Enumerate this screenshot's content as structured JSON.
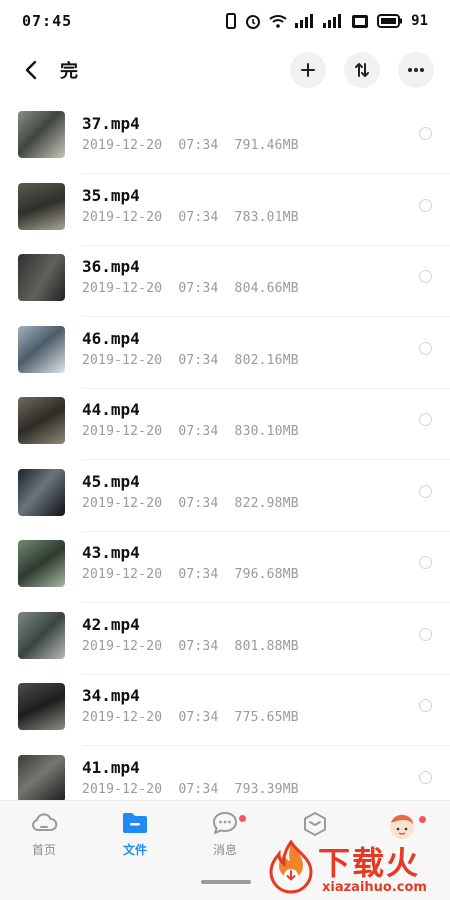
{
  "status_bar": {
    "time": "07:45",
    "battery_level": "91",
    "icons": [
      "vibrate-icon",
      "alarm-icon",
      "wifi-icon",
      "signal-icon",
      "signal-icon",
      "hd-icon",
      "battery-icon"
    ]
  },
  "header": {
    "title": "完",
    "icons": [
      "back-arrow-icon",
      "plus-icon",
      "sort-icon",
      "more-icon"
    ]
  },
  "files": [
    {
      "name": "37.mp4",
      "date": "2019-12-20",
      "time": "07:34",
      "size": "791.46MB"
    },
    {
      "name": "35.mp4",
      "date": "2019-12-20",
      "time": "07:34",
      "size": "783.01MB"
    },
    {
      "name": "36.mp4",
      "date": "2019-12-20",
      "time": "07:34",
      "size": "804.66MB"
    },
    {
      "name": "46.mp4",
      "date": "2019-12-20",
      "time": "07:34",
      "size": "802.16MB"
    },
    {
      "name": "44.mp4",
      "date": "2019-12-20",
      "time": "07:34",
      "size": "830.10MB"
    },
    {
      "name": "45.mp4",
      "date": "2019-12-20",
      "time": "07:34",
      "size": "822.98MB"
    },
    {
      "name": "43.mp4",
      "date": "2019-12-20",
      "time": "07:34",
      "size": "796.68MB"
    },
    {
      "name": "42.mp4",
      "date": "2019-12-20",
      "time": "07:34",
      "size": "801.88MB"
    },
    {
      "name": "34.mp4",
      "date": "2019-12-20",
      "time": "07:34",
      "size": "775.65MB"
    },
    {
      "name": "41.mp4",
      "date": "2019-12-20",
      "time": "07:34",
      "size": "793.39MB"
    }
  ],
  "tabs": [
    {
      "label": "首页",
      "icon": "cloud-icon",
      "active": false,
      "badge": false
    },
    {
      "label": "文件",
      "icon": "folder-icon",
      "active": true,
      "badge": false
    },
    {
      "label": "消息",
      "icon": "chat-icon",
      "active": false,
      "badge": true
    },
    {
      "label": "",
      "icon": "cube-icon",
      "active": false,
      "badge": false
    },
    {
      "label": "",
      "icon": "avatar-icon",
      "active": false,
      "badge": true
    }
  ],
  "watermark": {
    "text": "下载火",
    "url": "xiazaihuo.com"
  },
  "colors": {
    "accent": "#1f8bf3",
    "badge": "#f4565a",
    "meta_text": "#9a9a9a",
    "watermark": "#e63a24"
  }
}
